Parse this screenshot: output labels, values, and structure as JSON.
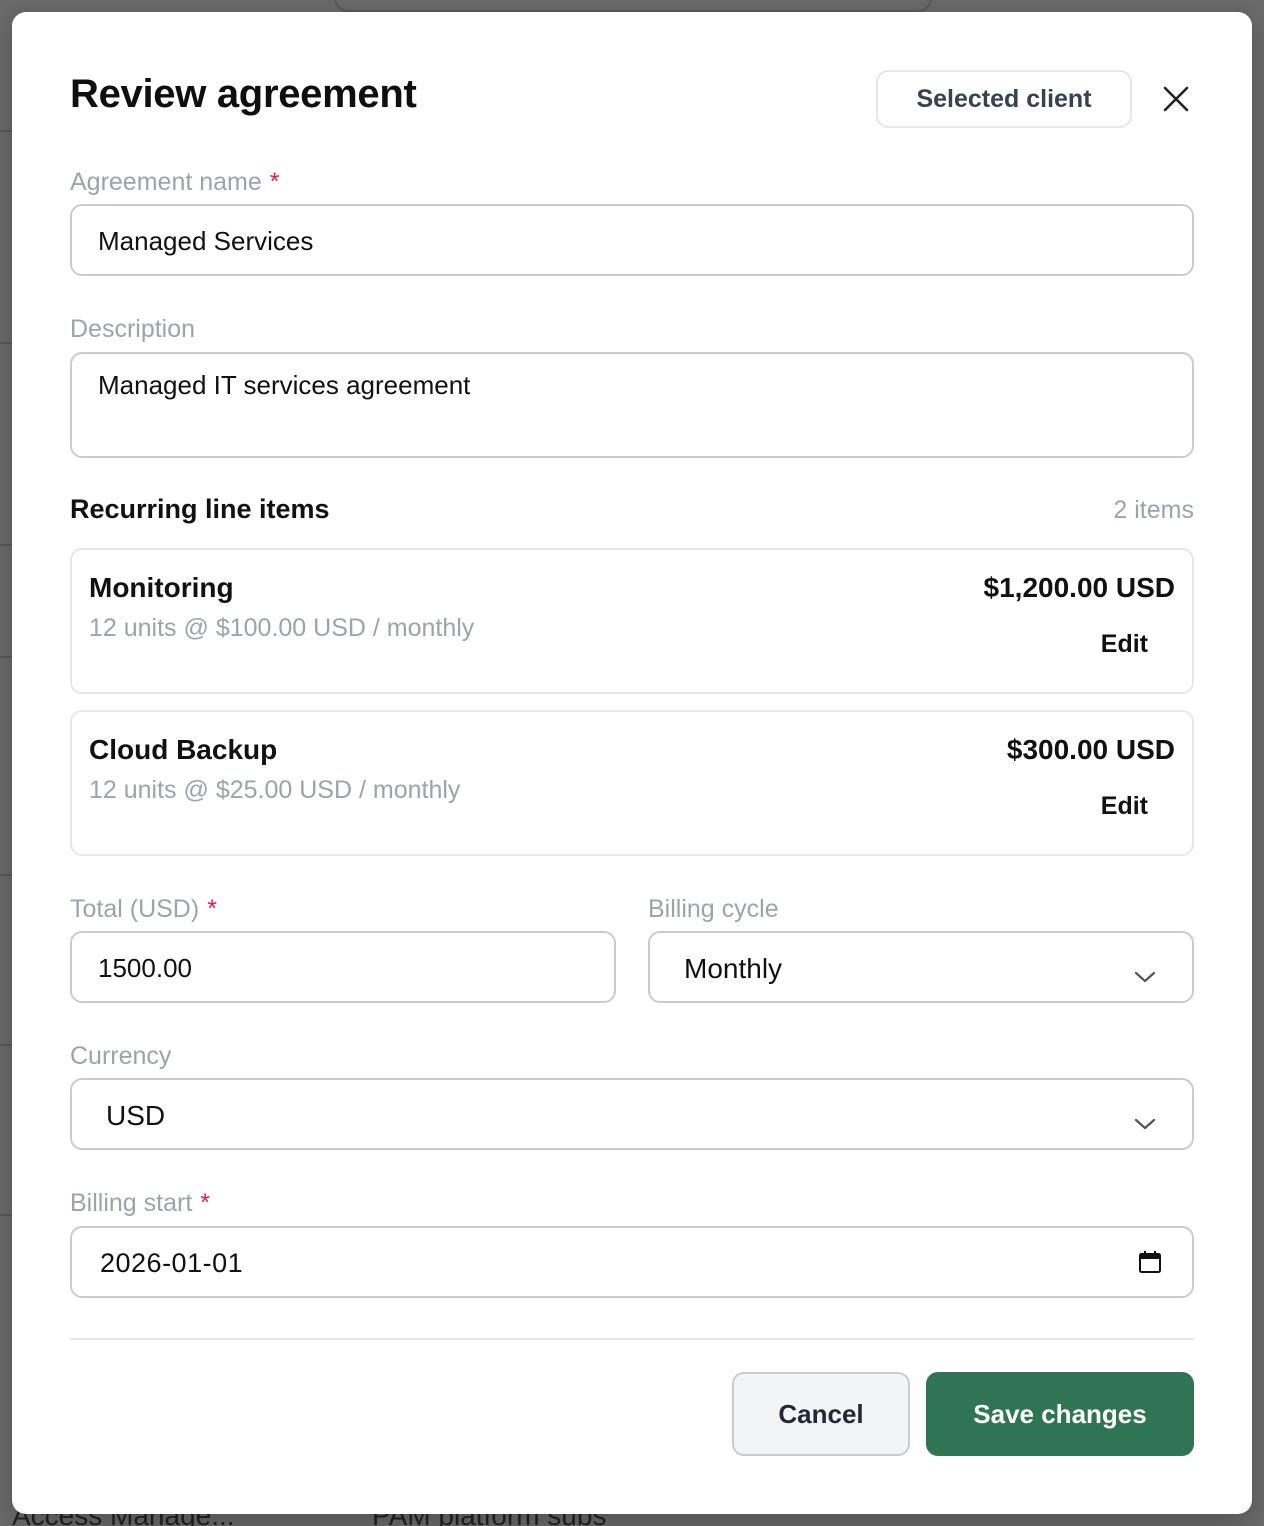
{
  "modal": {
    "title": "Review agreement",
    "selected_client_label": "Selected client",
    "close_icon": "close-icon"
  },
  "form": {
    "agreement_name": {
      "label": "Agreement name",
      "required_mark": "*",
      "value": "Managed Services"
    },
    "description": {
      "label": "Description",
      "value": "Managed IT services agreement"
    },
    "total": {
      "label": "Total (USD)",
      "required_mark": "*",
      "value": "1500.00"
    },
    "billing_cycle": {
      "label": "Billing cycle",
      "value": "Monthly",
      "icon": "chevron-down-icon"
    },
    "currency": {
      "label": "Currency",
      "value": "USD",
      "icon": "chevron-down-icon"
    },
    "billing_start": {
      "label": "Billing start",
      "required_mark": "*",
      "value": "2026-01-01",
      "icon": "calendar-icon"
    }
  },
  "line_items": {
    "title": "Recurring line items",
    "count_label": "2 items",
    "items": [
      {
        "name": "Monitoring",
        "detail": "12 units @ $100.00 USD / monthly",
        "amount": "$1,200.00 USD",
        "edit_label": "Edit"
      },
      {
        "name": "Cloud Backup",
        "detail": "12 units @ $25.00 USD / monthly",
        "amount": "$300.00 USD",
        "edit_label": "Edit"
      }
    ]
  },
  "footer": {
    "cancel_label": "Cancel",
    "save_label": "Save changes"
  },
  "background": {
    "bottom_text_left": "Access Manage...",
    "bottom_text_right": "PAM platform subs"
  },
  "colors": {
    "primary": "#2f7554",
    "required": "#e11d48",
    "muted_text": "#9ca3af",
    "border": "#c8ccd2",
    "overlay": "#6b6b6b"
  }
}
